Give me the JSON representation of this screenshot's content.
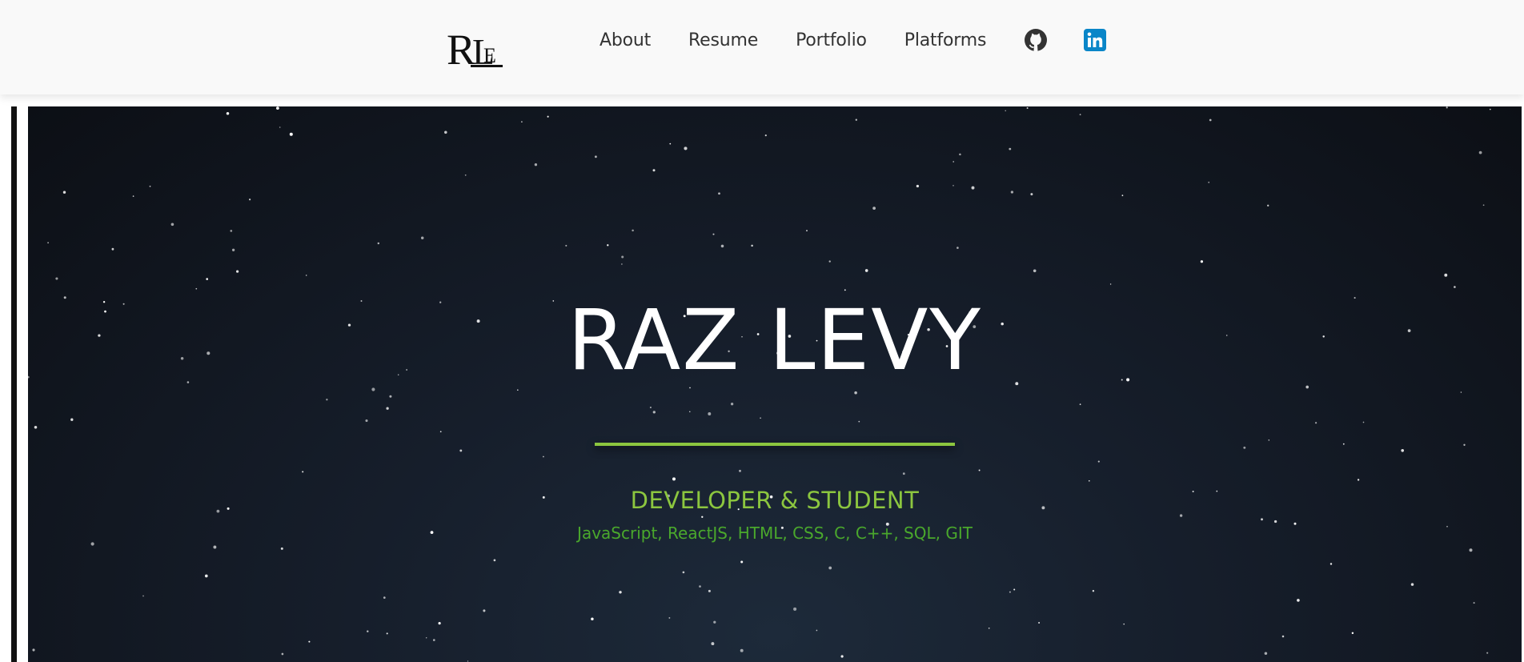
{
  "nav": {
    "logo_text": "RLE",
    "links": [
      {
        "label": "About"
      },
      {
        "label": "Resume"
      },
      {
        "label": "Portfolio"
      },
      {
        "label": "Platforms"
      }
    ],
    "icons": [
      {
        "name": "github-icon",
        "color": "#333333"
      },
      {
        "name": "linkedin-icon",
        "color": "#0a86c8"
      }
    ]
  },
  "hero": {
    "title": "RAZ LEVY",
    "subtitle": "DEVELOPER & STUDENT",
    "skills": "JavaScript, ReactJS, HTML, CSS, C, C++, SQL, GIT",
    "accent_color": "#8cc63f"
  }
}
